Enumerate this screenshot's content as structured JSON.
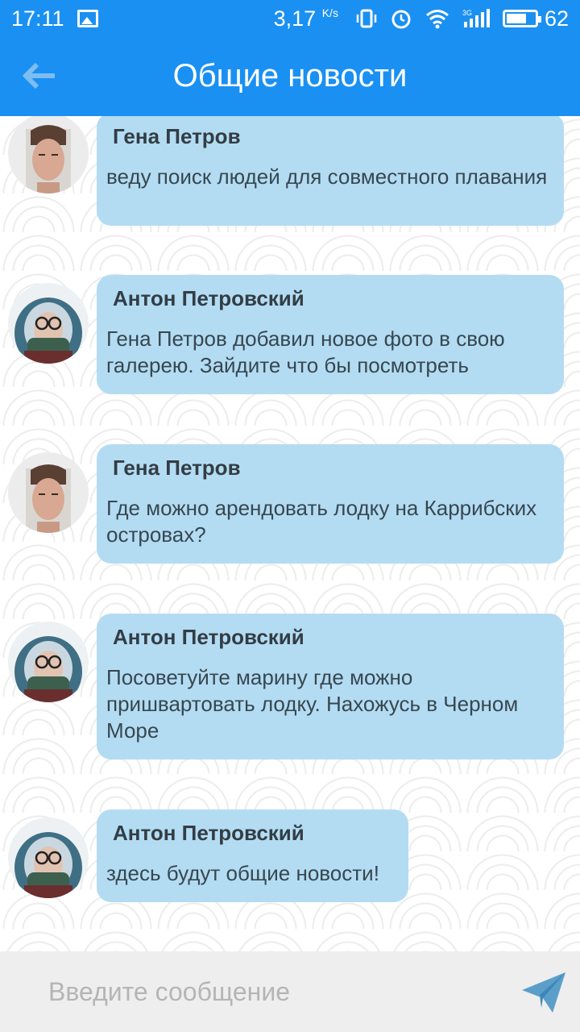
{
  "status_bar": {
    "time": "17:11",
    "speed": "3,17",
    "speed_unit": "K/s",
    "network": "3G",
    "battery": "62"
  },
  "app_bar": {
    "title": "Общие новости"
  },
  "messages": [
    {
      "author": "Гена Петров",
      "text": "веду поиск людей для совместного плавания",
      "avatar": "gena"
    },
    {
      "author": "Антон Петровский",
      "text": "Гена Петров добавил новое фото в свою галерею. Зайдите что бы посмотреть",
      "avatar": "anton"
    },
    {
      "author": "Гена Петров",
      "text": "Где можно арендовать лодку на Каррибских островах?",
      "avatar": "gena"
    },
    {
      "author": "Антон Петровский",
      "text": "Посоветуйте марину где можно пришвартовать лодку. Нахожусь в Черном Море",
      "avatar": "anton"
    },
    {
      "author": "Антон Петровский",
      "text": "здесь будут общие новости!",
      "avatar": "anton"
    }
  ],
  "input": {
    "placeholder": "Введите сообщение",
    "value": ""
  },
  "colors": {
    "primary": "#1a90f2",
    "bubble": "#b3dcf3",
    "input_bg": "#eeeeee",
    "send_icon": "#5b9ec9"
  }
}
